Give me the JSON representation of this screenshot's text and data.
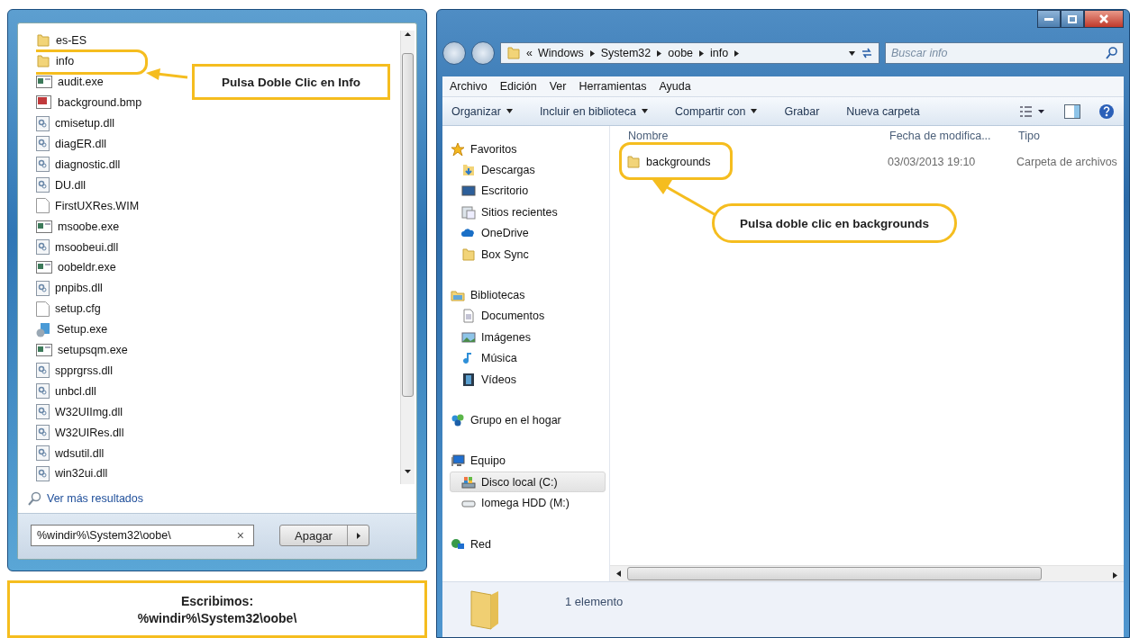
{
  "start_menu": {
    "items": [
      {
        "name": "es-ES",
        "kind": "folder",
        "highlighted": false
      },
      {
        "name": "info",
        "kind": "folder",
        "highlighted": true
      },
      {
        "name": "audit.exe",
        "kind": "exe",
        "highlighted": false
      },
      {
        "name": "background.bmp",
        "kind": "image",
        "highlighted": false
      },
      {
        "name": "cmisetup.dll",
        "kind": "dll",
        "highlighted": false
      },
      {
        "name": "diagER.dll",
        "kind": "dll",
        "highlighted": false
      },
      {
        "name": "diagnostic.dll",
        "kind": "dll",
        "highlighted": false
      },
      {
        "name": "DU.dll",
        "kind": "dll",
        "highlighted": false
      },
      {
        "name": "FirstUXRes.WIM",
        "kind": "file",
        "highlighted": false
      },
      {
        "name": "msoobe.exe",
        "kind": "exe",
        "highlighted": false
      },
      {
        "name": "msoobeui.dll",
        "kind": "dll",
        "highlighted": false
      },
      {
        "name": "oobeldr.exe",
        "kind": "exe",
        "highlighted": false
      },
      {
        "name": "pnpibs.dll",
        "kind": "dll",
        "highlighted": false
      },
      {
        "name": "setup.cfg",
        "kind": "file",
        "highlighted": false
      },
      {
        "name": "Setup.exe",
        "kind": "setup",
        "highlighted": false
      },
      {
        "name": "setupsqm.exe",
        "kind": "exe",
        "highlighted": false
      },
      {
        "name": "spprgrss.dll",
        "kind": "dll",
        "highlighted": false
      },
      {
        "name": "unbcl.dll",
        "kind": "dll",
        "highlighted": false
      },
      {
        "name": "W32UIImg.dll",
        "kind": "dll",
        "highlighted": false
      },
      {
        "name": "W32UIRes.dll",
        "kind": "dll",
        "highlighted": false
      },
      {
        "name": "wdsutil.dll",
        "kind": "dll",
        "highlighted": false
      },
      {
        "name": "win32ui.dll",
        "kind": "dll",
        "highlighted": false
      }
    ],
    "more_results": "Ver más resultados",
    "search": {
      "value": "%windir%\\System32\\oobe\\",
      "clear": "×"
    },
    "shutdown": {
      "label": "Apagar"
    }
  },
  "callouts": [
    {
      "text": "Pulsa Doble Clic en Info",
      "kind": "box"
    },
    {
      "text": "Pulsa doble clic en backgrounds",
      "kind": "pill"
    }
  ],
  "caption": {
    "title": "Escribimos:",
    "text": "%windir%\\System32\\oobe\\"
  },
  "explorer": {
    "breadcrumb_prefix": "«",
    "breadcrumb": [
      "Windows",
      "System32",
      "oobe",
      "info"
    ],
    "search": {
      "placeholder": "Buscar info"
    },
    "menu": [
      "Archivo",
      "Edición",
      "Ver",
      "Herramientas",
      "Ayuda"
    ],
    "toolbar": [
      {
        "label": "Organizar",
        "dropdown": true
      },
      {
        "label": "Incluir en biblioteca",
        "dropdown": true
      },
      {
        "label": "Compartir con",
        "dropdown": true
      },
      {
        "label": "Grabar",
        "dropdown": false
      },
      {
        "label": "Nueva carpeta",
        "dropdown": false
      }
    ],
    "nav": [
      {
        "label": "Favoritos",
        "kind": "star",
        "selected": false,
        "children": [
          {
            "label": "Descargas",
            "kind": "downloads",
            "selected": false
          },
          {
            "label": "Escritorio",
            "kind": "desktop",
            "selected": false
          },
          {
            "label": "Sitios recientes",
            "kind": "recent",
            "selected": false
          },
          {
            "label": "OneDrive",
            "kind": "cloud",
            "selected": false
          },
          {
            "label": "Box Sync",
            "kind": "folder",
            "selected": false
          }
        ]
      },
      {
        "label": "Bibliotecas",
        "kind": "library",
        "selected": false,
        "children": [
          {
            "label": "Documentos",
            "kind": "document",
            "selected": false
          },
          {
            "label": "Imágenes",
            "kind": "picture",
            "selected": false
          },
          {
            "label": "Música",
            "kind": "music",
            "selected": false
          },
          {
            "label": "Vídeos",
            "kind": "video",
            "selected": false
          }
        ]
      },
      {
        "label": "Grupo en el hogar",
        "kind": "homegroup",
        "selected": false
      },
      {
        "label": "Equipo",
        "kind": "computer",
        "selected": false,
        "children": [
          {
            "label": "Disco local (C:)",
            "kind": "disk",
            "selected": true
          },
          {
            "label": "Iomega HDD (M:)",
            "kind": "drive",
            "selected": false
          }
        ]
      },
      {
        "label": "Red",
        "kind": "network",
        "selected": false
      }
    ],
    "columns": [
      "Nombre",
      "Fecha de modifica...",
      "Tipo"
    ],
    "rows": [
      {
        "name": "backgrounds",
        "date": "03/03/2013 19:10",
        "type": "Carpeta de archivos",
        "highlighted": true
      }
    ],
    "status": "1 elemento"
  }
}
